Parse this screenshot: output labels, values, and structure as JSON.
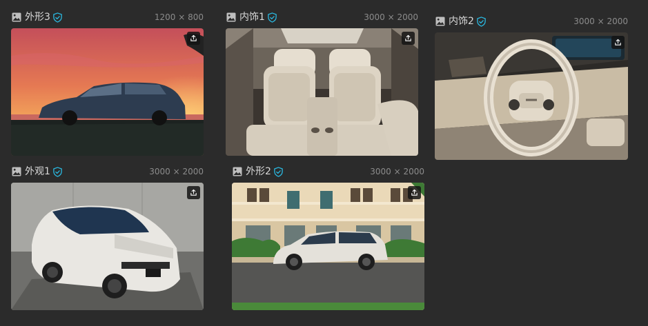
{
  "items": [
    {
      "title": "外形3",
      "dims": "1200 × 800",
      "image": "sunset-car-photo",
      "upload_icon": "upload-icon"
    },
    {
      "title": "内饰1",
      "dims": "3000 × 2000",
      "image": "car-interior-seats-photo",
      "upload_icon": "upload-icon"
    },
    {
      "title": "内饰2",
      "dims": "3000 × 2000",
      "image": "steering-wheel-photo",
      "upload_icon": "upload-icon"
    },
    {
      "title": "外观1",
      "dims": "3000 × 2000",
      "image": "white-mpv-photo",
      "upload_icon": "upload-icon"
    },
    {
      "title": "外形2",
      "dims": "3000 × 2000",
      "image": "mpv-street-photo",
      "upload_icon": "upload-icon"
    }
  ],
  "colors": {
    "verified": "#2ab8e0",
    "background": "#2b2b2b",
    "title_text": "#d9d9d9",
    "dims_text": "#8c8c8c"
  }
}
